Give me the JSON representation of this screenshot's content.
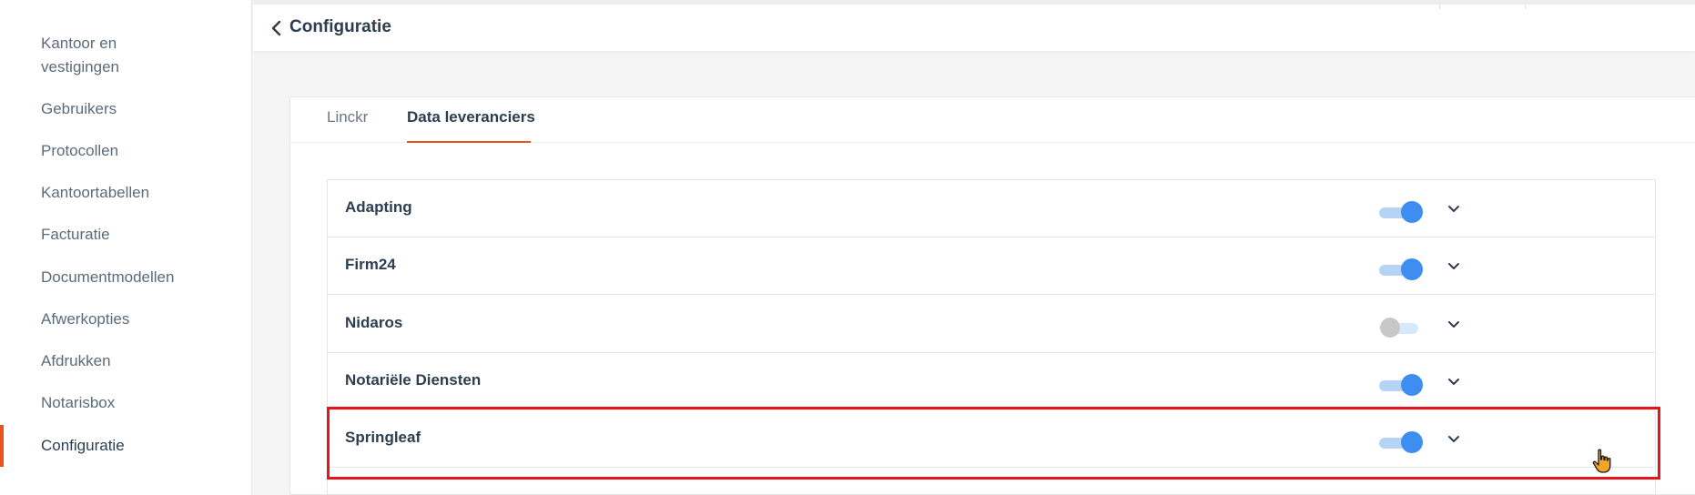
{
  "sidebar": {
    "items": [
      {
        "label": "Kantoor en vestigingen"
      },
      {
        "label": "Gebruikers"
      },
      {
        "label": "Protocollen"
      },
      {
        "label": "Kantoortabellen"
      },
      {
        "label": "Facturatie"
      },
      {
        "label": "Documentmodellen"
      },
      {
        "label": "Afwerkopties"
      },
      {
        "label": "Afdrukken"
      },
      {
        "label": "Notarisbox"
      },
      {
        "label": "Configuratie"
      }
    ],
    "active": "Configuratie"
  },
  "header": {
    "title": "Configuratie",
    "back_icon": "chevron-left-icon"
  },
  "tabs": [
    {
      "label": "Linckr",
      "active": false
    },
    {
      "label": "Data leveranciers",
      "active": true
    }
  ],
  "suppliers": [
    {
      "name": "Adapting",
      "enabled": true
    },
    {
      "name": "Firm24",
      "enabled": true
    },
    {
      "name": "Nidaros",
      "enabled": false
    },
    {
      "name": "Notariële Diensten",
      "enabled": true
    },
    {
      "name": "Springleaf",
      "enabled": true
    }
  ],
  "colors": {
    "accent": "#e8541e",
    "toggle_on": "#3d8ef0",
    "toggle_off": "#c8c8c8",
    "highlight": "#e8141c"
  }
}
